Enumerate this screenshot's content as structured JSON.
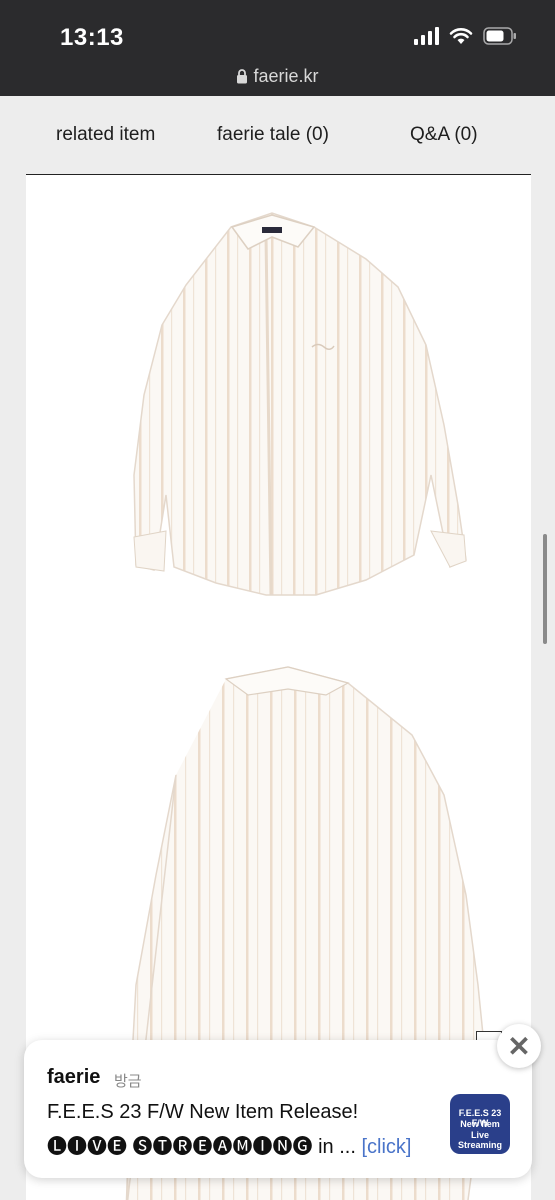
{
  "status_bar": {
    "time": "13:13"
  },
  "browser": {
    "url": "faerie.kr"
  },
  "tabs": [
    {
      "label": "related item"
    },
    {
      "label": "faerie tale (0)"
    },
    {
      "label": "Q&A (0)"
    }
  ],
  "notification": {
    "sender": "faerie",
    "time": "방금",
    "title": "F.E.E.S 23 F/W New Item Release!",
    "body_prefix": "🅛🅘🅥🅔 🅢🅣🅡🅔🅐🅜🅘🅝🅖 in ...",
    "link_text": "[click]",
    "thumbnail_lines": [
      "F.E.E.S 23 F/W",
      "New Item",
      "Live Streaming"
    ]
  },
  "colors": {
    "status_bar_bg": "#2b2b2d",
    "page_bg": "#ededed",
    "link": "#4a74c9",
    "stripe": "#e8d8c8"
  }
}
